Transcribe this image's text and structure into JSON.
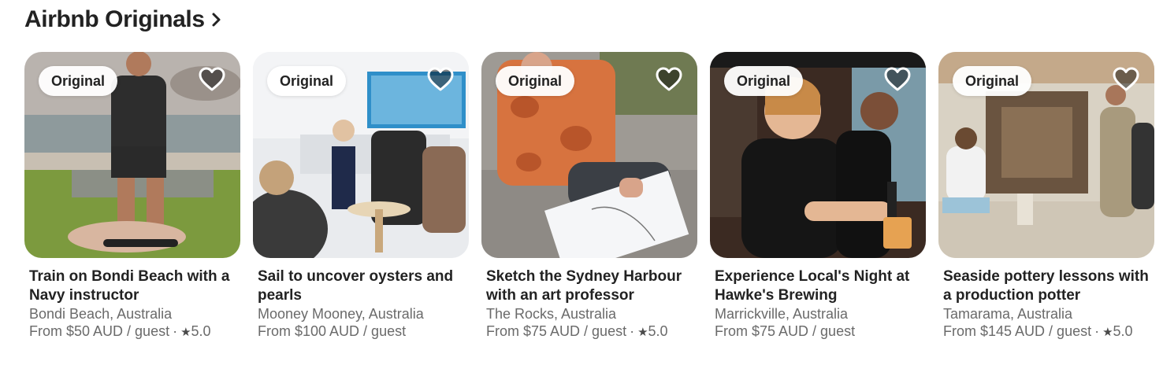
{
  "section": {
    "title": "Airbnb Originals"
  },
  "cards": [
    {
      "badge": "Original",
      "title": "Train on Bondi Beach with a Navy instructor",
      "location": "Bondi Beach, Australia",
      "price": "From $50 AUD / guest",
      "separator": "·",
      "rating": "5.0"
    },
    {
      "badge": "Original",
      "title": "Sail to uncover oysters and pearls",
      "location": "Mooney Mooney, Australia",
      "price": "From $100 AUD / guest"
    },
    {
      "badge": "Original",
      "title": "Sketch the Sydney Harbour with an art professor",
      "location": "The Rocks, Australia",
      "price": "From $75 AUD / guest",
      "separator": "·",
      "rating": "5.0"
    },
    {
      "badge": "Original",
      "title": "Experience Local's Night at Hawke's Brewing",
      "location": "Marrickville, Australia",
      "price": "From $75 AUD / guest"
    },
    {
      "badge": "Original",
      "title": "Seaside pottery lessons with a production potter",
      "location": "Tamarama, Australia",
      "price": "From $145 AUD / guest",
      "separator": "·",
      "rating": "5.0"
    }
  ],
  "icons": {
    "section_chevron": "chevron-right-icon",
    "heart": "heart-outline-icon",
    "star": "star-icon"
  },
  "colors": {
    "text": "#222222",
    "muted": "#6a6a6a",
    "background": "#ffffff"
  }
}
